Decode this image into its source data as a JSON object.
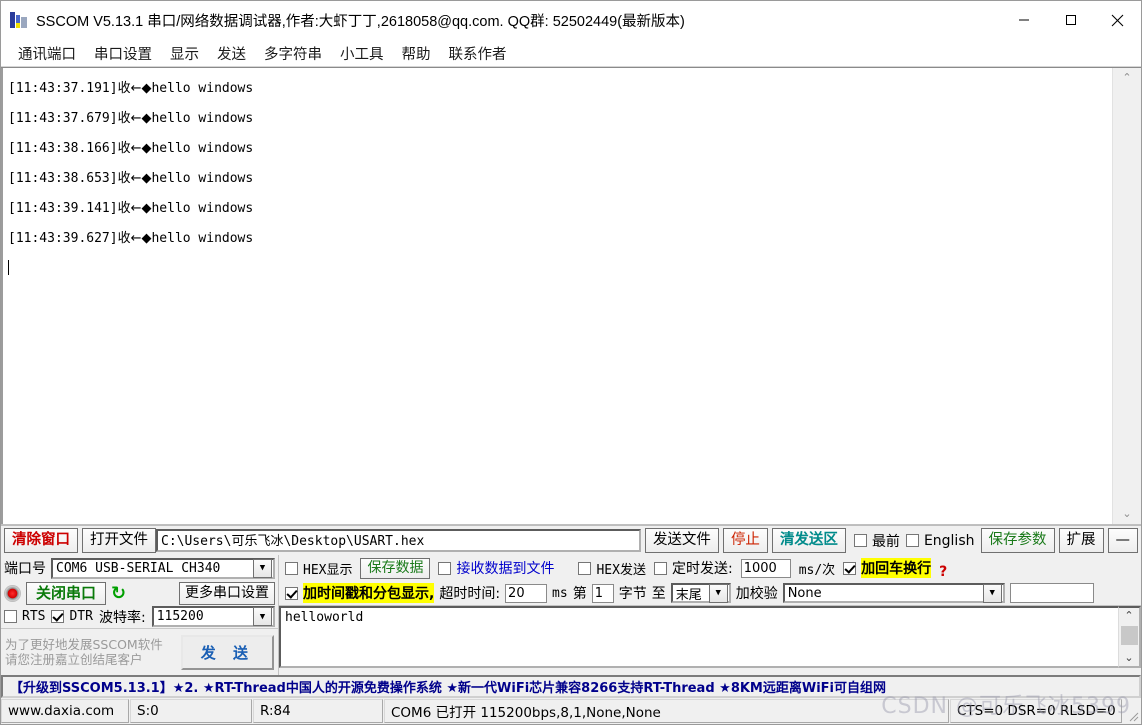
{
  "window": {
    "title": "SSCOM V5.13.1 串口/网络数据调试器,作者:大虾丁丁,2618058@qq.com. QQ群: 52502449(最新版本)",
    "icon": "sscom-app-icon",
    "minimize": "—",
    "maximize": "□",
    "close": "✕"
  },
  "menubar": {
    "items": [
      {
        "label": "通讯端口"
      },
      {
        "label": "串口设置"
      },
      {
        "label": "显示"
      },
      {
        "label": "发送"
      },
      {
        "label": "多字符串"
      },
      {
        "label": "小工具"
      },
      {
        "label": "帮助"
      },
      {
        "label": "联系作者"
      }
    ]
  },
  "receive": {
    "lines": [
      {
        "time": "[11:43:37.191]",
        "dir": "收",
        "arrow": "←◆",
        "text": "hello windows"
      },
      {
        "time": "[11:43:37.679]",
        "dir": "收",
        "arrow": "←◆",
        "text": "hello windows"
      },
      {
        "time": "[11:43:38.166]",
        "dir": "收",
        "arrow": "←◆",
        "text": "hello windows"
      },
      {
        "time": "[11:43:38.653]",
        "dir": "收",
        "arrow": "←◆",
        "text": "hello windows"
      },
      {
        "time": "[11:43:39.141]",
        "dir": "收",
        "arrow": "←◆",
        "text": "hello windows"
      },
      {
        "time": "[11:43:39.627]",
        "dir": "收",
        "arrow": "←◆",
        "text": "hello windows"
      }
    ],
    "scroll_up": "⌃",
    "scroll_down": "⌄"
  },
  "toolbar": {
    "clear_window": "清除窗口",
    "open_file": "打开文件",
    "file_path": "C:\\Users\\可乐飞冰\\Desktop\\USART.hex",
    "send_file": "发送文件",
    "stop": "停止",
    "clear_send": "清发送区",
    "topmost_label": "最前",
    "topmost_checked": false,
    "english_label": "English",
    "english_checked": false,
    "save_params": "保存参数",
    "extend": "扩展",
    "collapse": "—"
  },
  "port": {
    "port_label": "端口号",
    "port_value": "COM6  USB-SERIAL CH340",
    "close_port_button": "关闭串口",
    "refresh_icon": "refresh-icon",
    "led_icon": "port-status-led",
    "more_settings": "更多串口设置",
    "rts_label": "RTS",
    "rts_checked": false,
    "dtr_label": "DTR",
    "dtr_checked": true,
    "baud_label": "波特率:",
    "baud_value": "115200",
    "promo_line1": "为了更好地发展SSCOM软件",
    "promo_line2": "请您注册嘉立创结尾客户",
    "send_button": "发  送"
  },
  "options": {
    "hex_show_label": "HEX显示",
    "hex_show_checked": false,
    "save_data_button": "保存数据",
    "recv_to_file_label": "接收数据到文件",
    "recv_to_file_checked": false,
    "hex_send_label": "HEX发送",
    "hex_send_checked": false,
    "timed_send_label": "定时发送:",
    "timed_send_checked": false,
    "timed_send_value": "1000",
    "timed_send_unit": "ms/次",
    "crlf_label": "加回车换行",
    "crlf_checked": true,
    "help_mark": "?",
    "timestamp_label": "加时间戳和分包显示,",
    "timestamp_checked": true,
    "timeout_label": "超时时间:",
    "timeout_value": "20",
    "timeout_unit": "ms",
    "byte_from_label": "第",
    "byte_from_value": "1",
    "byte_label": "字节",
    "byte_to_label": "至",
    "byte_to_value": "末尾",
    "checksum_label": "加校验",
    "checksum_value": "None",
    "checksum_extra": ""
  },
  "send_area": {
    "text": "helloworld",
    "scroll_up": "⌃",
    "scroll_down": "⌄"
  },
  "adbar": {
    "text": "【升级到SSCOM5.13.1】★2.  ★RT-Thread中国人的开源免费操作系统 ★新一代WiFi芯片兼容8266支持RT-Thread ★8KM远距离WiFi可自组网"
  },
  "statusbar": {
    "site": "www.daxia.com",
    "sent": "S:0",
    "received": "R:84",
    "connection": "COM6 已打开  115200bps,8,1,None,None",
    "signals": "CTS=0 DSR=0 RLSD=0",
    "watermark": "CSDN @可乐飞冰5399"
  }
}
